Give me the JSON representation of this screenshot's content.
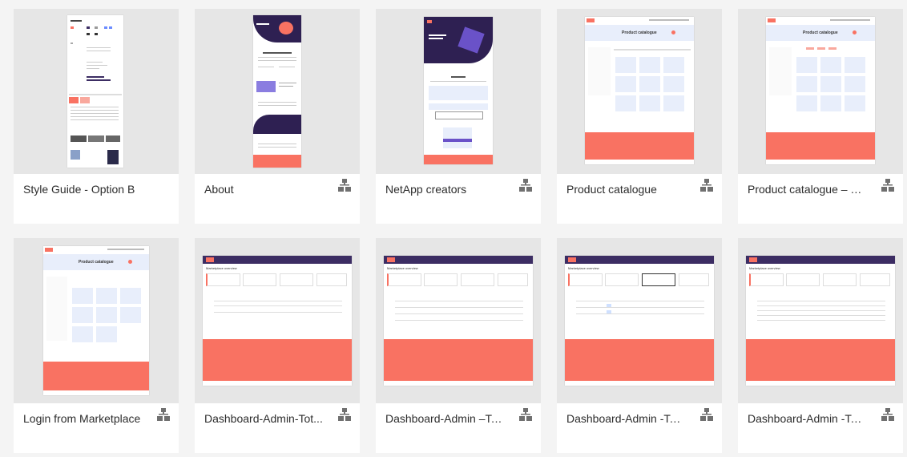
{
  "colors": {
    "accent": "#f97262",
    "header": "#3c2d63",
    "card_bg": "#ffffff",
    "thumb_bg": "#e6e6e6",
    "icon": "#707070"
  },
  "cards": [
    {
      "label": "Style Guide - Option B",
      "icon": "none"
    },
    {
      "label": "About",
      "icon": "flow-icon"
    },
    {
      "label": "NetApp creators",
      "icon": "flow-icon"
    },
    {
      "label": "Product catalogue",
      "icon": "flow-icon"
    },
    {
      "label": "Product catalogue –  R...",
      "icon": "flow-icon"
    },
    {
      "label": "Login from Marketplace",
      "icon": "flow-icon"
    },
    {
      "label": "Dashboard-Admin-Tot...",
      "icon": "flow-icon"
    },
    {
      "label": "Dashboard-Admin –To...",
      "icon": "flow-icon"
    },
    {
      "label": "Dashboard-Admin -Tot...",
      "icon": "flow-icon"
    },
    {
      "label": "Dashboard-Admin -Tot...",
      "icon": "flow-icon"
    }
  ],
  "thumbs": {
    "product_title": "Product catalogue",
    "dash_title": "Marketplace overview"
  }
}
